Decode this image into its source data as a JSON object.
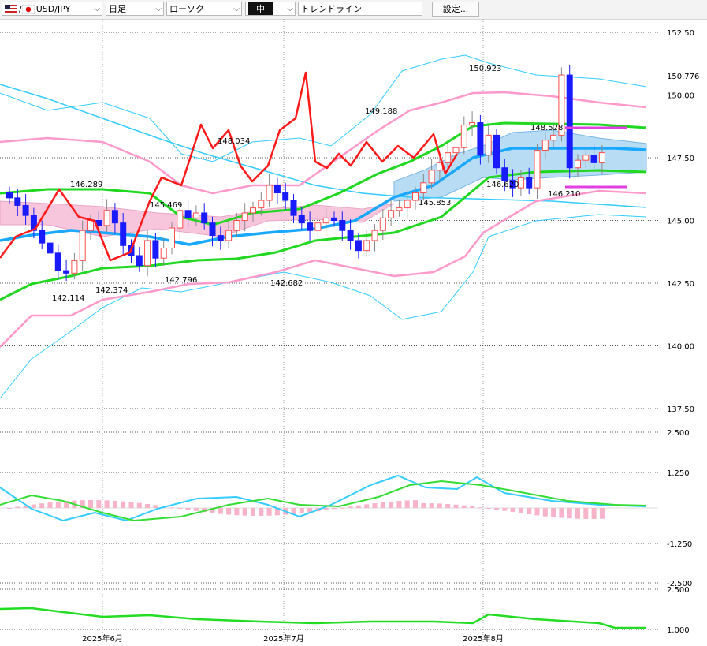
{
  "toolbar": {
    "symbol": "USD/JPY",
    "timeframe": "日足",
    "chart_style": "ローソク",
    "size": "中",
    "tool": "トレンドライン",
    "settings_label": "設定..."
  },
  "colors": {
    "candle_up": "#ff4d4d",
    "candle_down": "#1a1aff",
    "conversion_line": "#ff1a1a",
    "bb_mid": "#19a8ff",
    "bb_1sigma": "#1fd81f",
    "bb_2sigma": "#ff99cc",
    "bb_3sigma": "#33ccff",
    "cloud_bull": "#b9dcf5",
    "cloud_bear": "#f7c6dc",
    "macd_line": "#33ccff",
    "macd_signal": "#33dd33",
    "macd_hist": "#f7b4c9",
    "lower_line": "#22dd22",
    "hline_magenta": "#e040e0"
  },
  "chart_data": {
    "type": "candlestick",
    "price_axis": {
      "ylim": [
        136.5,
        153.0
      ],
      "ticks": [
        "152.50",
        "150.00",
        "147.50",
        "145.00",
        "142.50",
        "140.00",
        "137.50"
      ],
      "current_price": "150.776"
    },
    "time_axis": {
      "labels": [
        "2025年6月",
        "2025年7月",
        "2025年8月"
      ]
    },
    "annotations": [
      "142.114",
      "146.289",
      "142.374",
      "145.469",
      "142.796",
      "148.034",
      "142.682",
      "149.188",
      "145.853",
      "150.923",
      "148.528",
      "146.620",
      "146.210"
    ],
    "macd_axis": {
      "ylim": [
        -2.6,
        2.6
      ],
      "ticks": [
        "2.500",
        "1.250",
        "-1.250",
        "-2.500"
      ]
    },
    "lower_axis": {
      "ylim": [
        0.95,
        2.6
      ],
      "ticks": [
        "2.500",
        "1.000"
      ]
    }
  }
}
